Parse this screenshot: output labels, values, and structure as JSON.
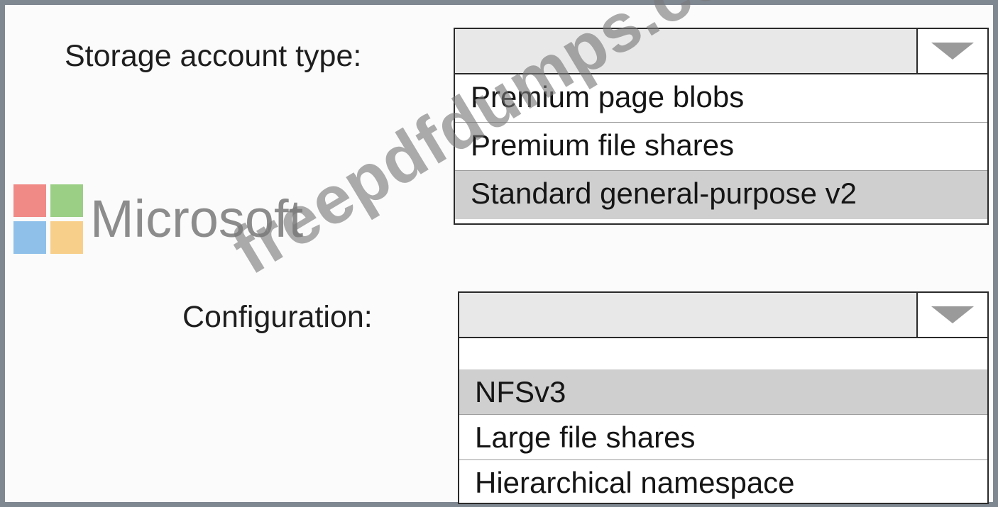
{
  "storage": {
    "label": "Storage account type:",
    "selected_value": "",
    "options": [
      {
        "label": "Premium page blobs",
        "selected": false
      },
      {
        "label": "Premium file shares",
        "selected": false
      },
      {
        "label": "Standard general-purpose v2",
        "selected": true
      }
    ]
  },
  "configuration": {
    "label": "Configuration:",
    "selected_value": "",
    "options": [
      {
        "label": "NFSv3",
        "selected": true
      },
      {
        "label": "Large file shares",
        "selected": false
      },
      {
        "label": "Hierarchical namespace",
        "selected": false
      }
    ]
  },
  "logo": {
    "text": "Microsoft",
    "colors": {
      "red": "#f08a86",
      "green": "#9bcf86",
      "blue": "#8fc0ea",
      "yellow": "#f8cf8a"
    }
  },
  "watermark": {
    "text": "freepdfdumps.com"
  },
  "icons": {
    "dropdown_arrow": "chevron-down-icon"
  }
}
